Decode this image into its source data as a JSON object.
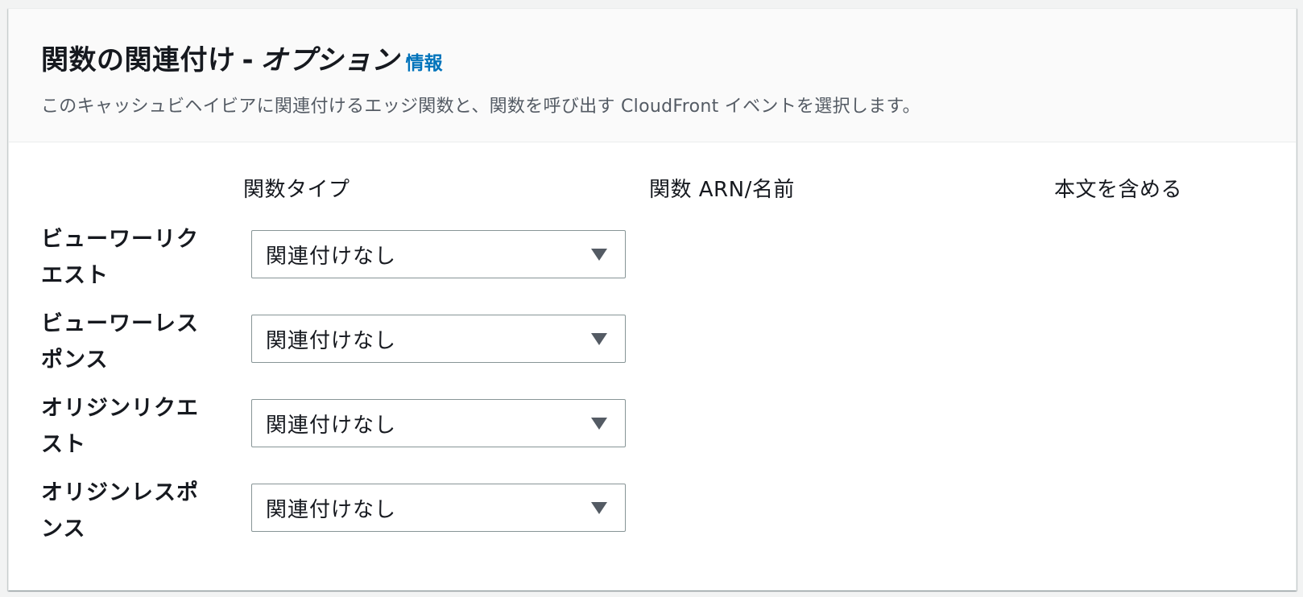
{
  "header": {
    "title_main": "関数の関連付け",
    "title_sep": "-",
    "title_optional": "オプション",
    "info_link": "情報",
    "description": "このキャッシュビヘイビアに関連付けるエッジ関数と、関数を呼び出す CloudFront イベントを選択します。"
  },
  "columns": {
    "function_type": "関数タイプ",
    "function_arn": "関数 ARN/名前",
    "include_body": "本文を含める"
  },
  "rows": [
    {
      "label_line1": "ビューワーリク",
      "label_line2": "エスト",
      "select_value": "関連付けなし"
    },
    {
      "label_line1": "ビューワーレス",
      "label_line2": "ポンス",
      "select_value": "関連付けなし"
    },
    {
      "label_line1": "オリジンリクエ",
      "label_line2": "スト",
      "select_value": "関連付けなし"
    },
    {
      "label_line1": "オリジンレスポ",
      "label_line2": "ンス",
      "select_value": "関連付けなし"
    }
  ],
  "icons": {
    "dropdown": "caret-down-icon"
  },
  "colors": {
    "link": "#0073bb",
    "text": "#16191f",
    "muted": "#545b64",
    "border": "#879596"
  }
}
